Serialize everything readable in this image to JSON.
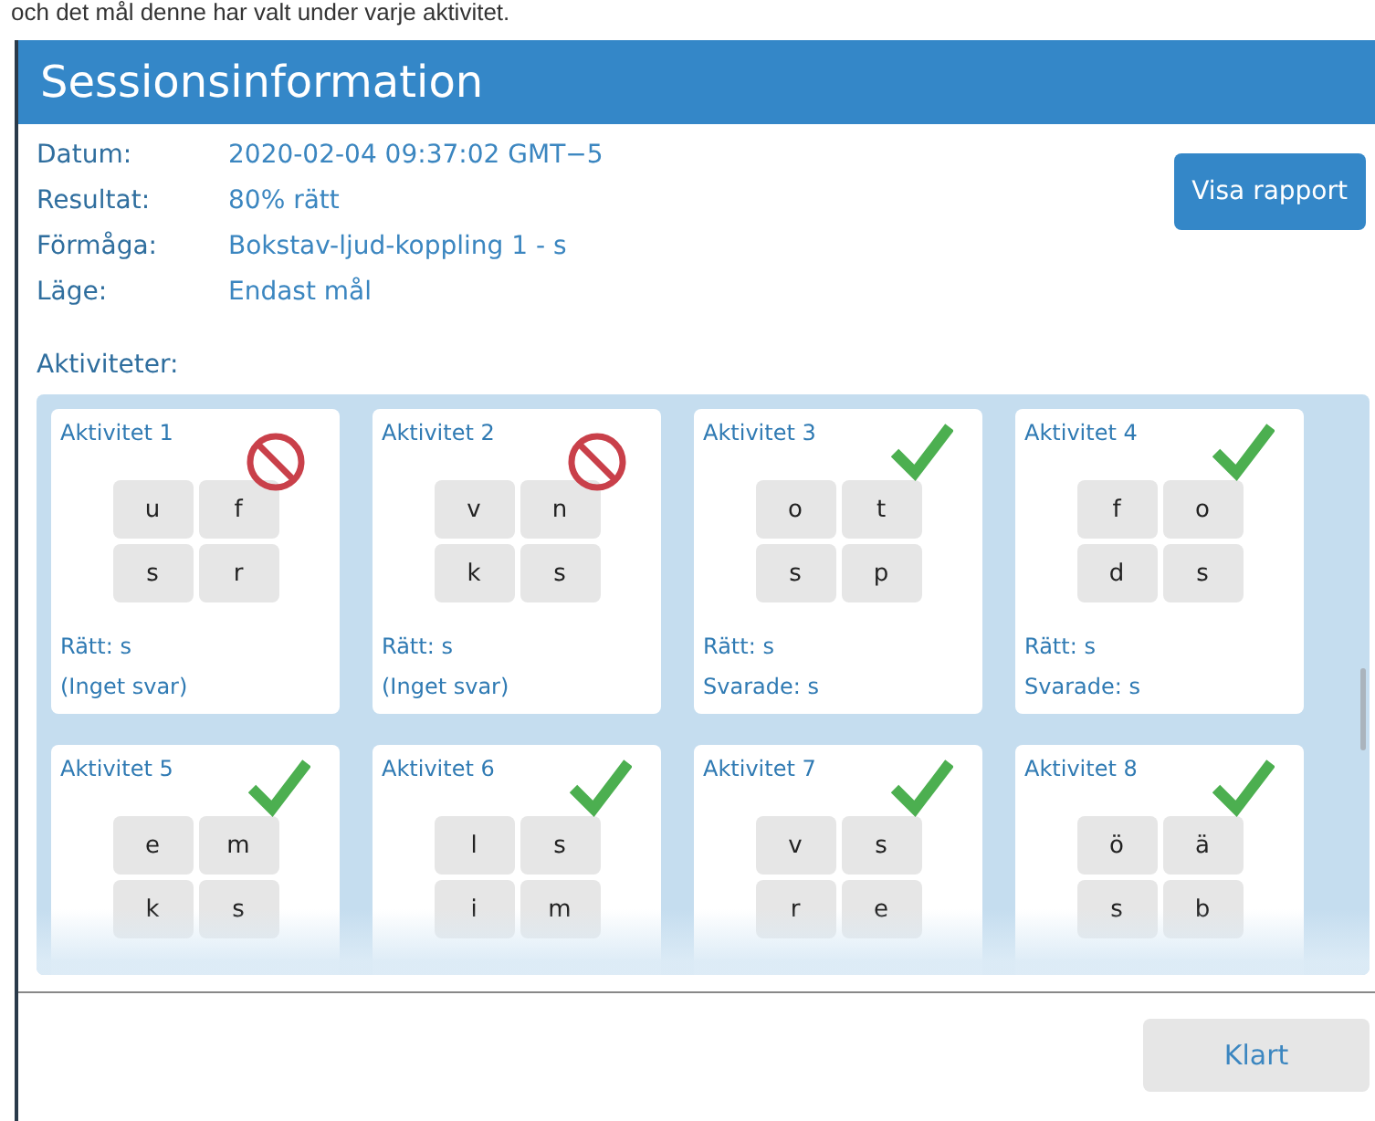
{
  "background_text": "och det mål denne har valt under varje aktivitet.",
  "dialog": {
    "title": "Sessionsinformation",
    "details": [
      {
        "label": "Datum:",
        "value": "2020-02-04 09:37:02 GMT−5"
      },
      {
        "label": "Resultat:",
        "value": "80% rätt"
      },
      {
        "label": "Förmåga:",
        "value": "Bokstav-ljud-koppling 1 - s"
      },
      {
        "label": "Läge:",
        "value": "Endast mål"
      }
    ],
    "report_button": "Visa rapport",
    "activities_label": "Aktiviteter:",
    "activities": [
      {
        "title": "Aktivitet 1",
        "kind": "blocked",
        "letters": [
          "u",
          "f",
          "s",
          "r"
        ],
        "correct": "Rätt: s",
        "answer": "(Inget svar)"
      },
      {
        "title": "Aktivitet 2",
        "kind": "blocked",
        "letters": [
          "v",
          "n",
          "k",
          "s"
        ],
        "correct": "Rätt: s",
        "answer": "(Inget svar)"
      },
      {
        "title": "Aktivitet 3",
        "kind": "correct",
        "letters": [
          "o",
          "t",
          "s",
          "p"
        ],
        "correct": "Rätt: s",
        "answer": "Svarade: s"
      },
      {
        "title": "Aktivitet 4",
        "kind": "correct",
        "letters": [
          "f",
          "o",
          "d",
          "s"
        ],
        "correct": "Rätt: s",
        "answer": "Svarade: s"
      },
      {
        "title": "Aktivitet 5",
        "kind": "correct",
        "letters": [
          "e",
          "m",
          "k",
          "s"
        ]
      },
      {
        "title": "Aktivitet 6",
        "kind": "correct",
        "letters": [
          "l",
          "s",
          "i",
          "m"
        ]
      },
      {
        "title": "Aktivitet 7",
        "kind": "correct",
        "letters": [
          "v",
          "s",
          "r",
          "e"
        ]
      },
      {
        "title": "Aktivitet 8",
        "kind": "correct",
        "letters": [
          "ö",
          "ä",
          "s",
          "b"
        ]
      }
    ],
    "done_button": "Klart"
  }
}
